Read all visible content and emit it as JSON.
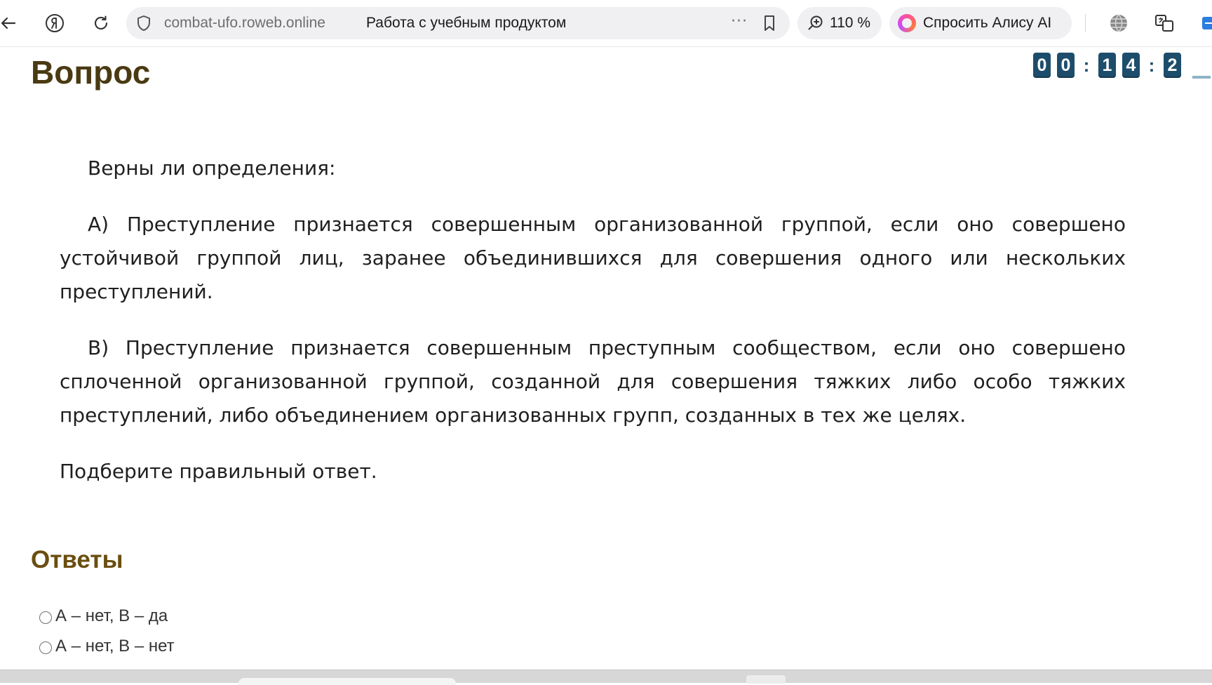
{
  "browser": {
    "address_domain": "combat-ufo.roweb.online",
    "page_title": "Работа с учебным продуктом",
    "more_label": "···",
    "zoom_label": "110 %",
    "alice_label": "Спросить Алису AI",
    "icons": [
      "back-icon",
      "yandex-logo-icon",
      "reload-icon",
      "shield-icon",
      "bookmark-icon",
      "zoom-icon",
      "alice-icon",
      "globe-icon",
      "translate-icon",
      "extension-icon"
    ]
  },
  "timer": {
    "digits": [
      "0",
      "0",
      "1",
      "4",
      "2"
    ],
    "separator": ":"
  },
  "question": {
    "heading": "Вопрос",
    "intro": "Верны ли определения:",
    "statement_a": "А) Преступление признается совершенным организованной группой, если оно совершено устойчивой группой лиц, заранее объединившихся для совершения одного или нескольких преступлений.",
    "statement_b": "В) Преступление признается совершенным преступным сообществом, если оно совершено сплоченной организованной группой, созданной для совершения тяжких либо особо тяжких преступлений, либо объединением организованных групп, созданных в тех же целях.",
    "instruction": "Подберите правильный ответ."
  },
  "answers": {
    "heading": "Ответы",
    "options": [
      {
        "label": "А – нет, В – да",
        "selected": false
      },
      {
        "label": "А – нет, В – нет",
        "selected": false
      }
    ]
  },
  "colors": {
    "heading": "#4a3a12",
    "answers_heading": "#6a4e10",
    "timer_bg": "#1d4d6b",
    "toolbar_pill": "#f0f0f2"
  }
}
